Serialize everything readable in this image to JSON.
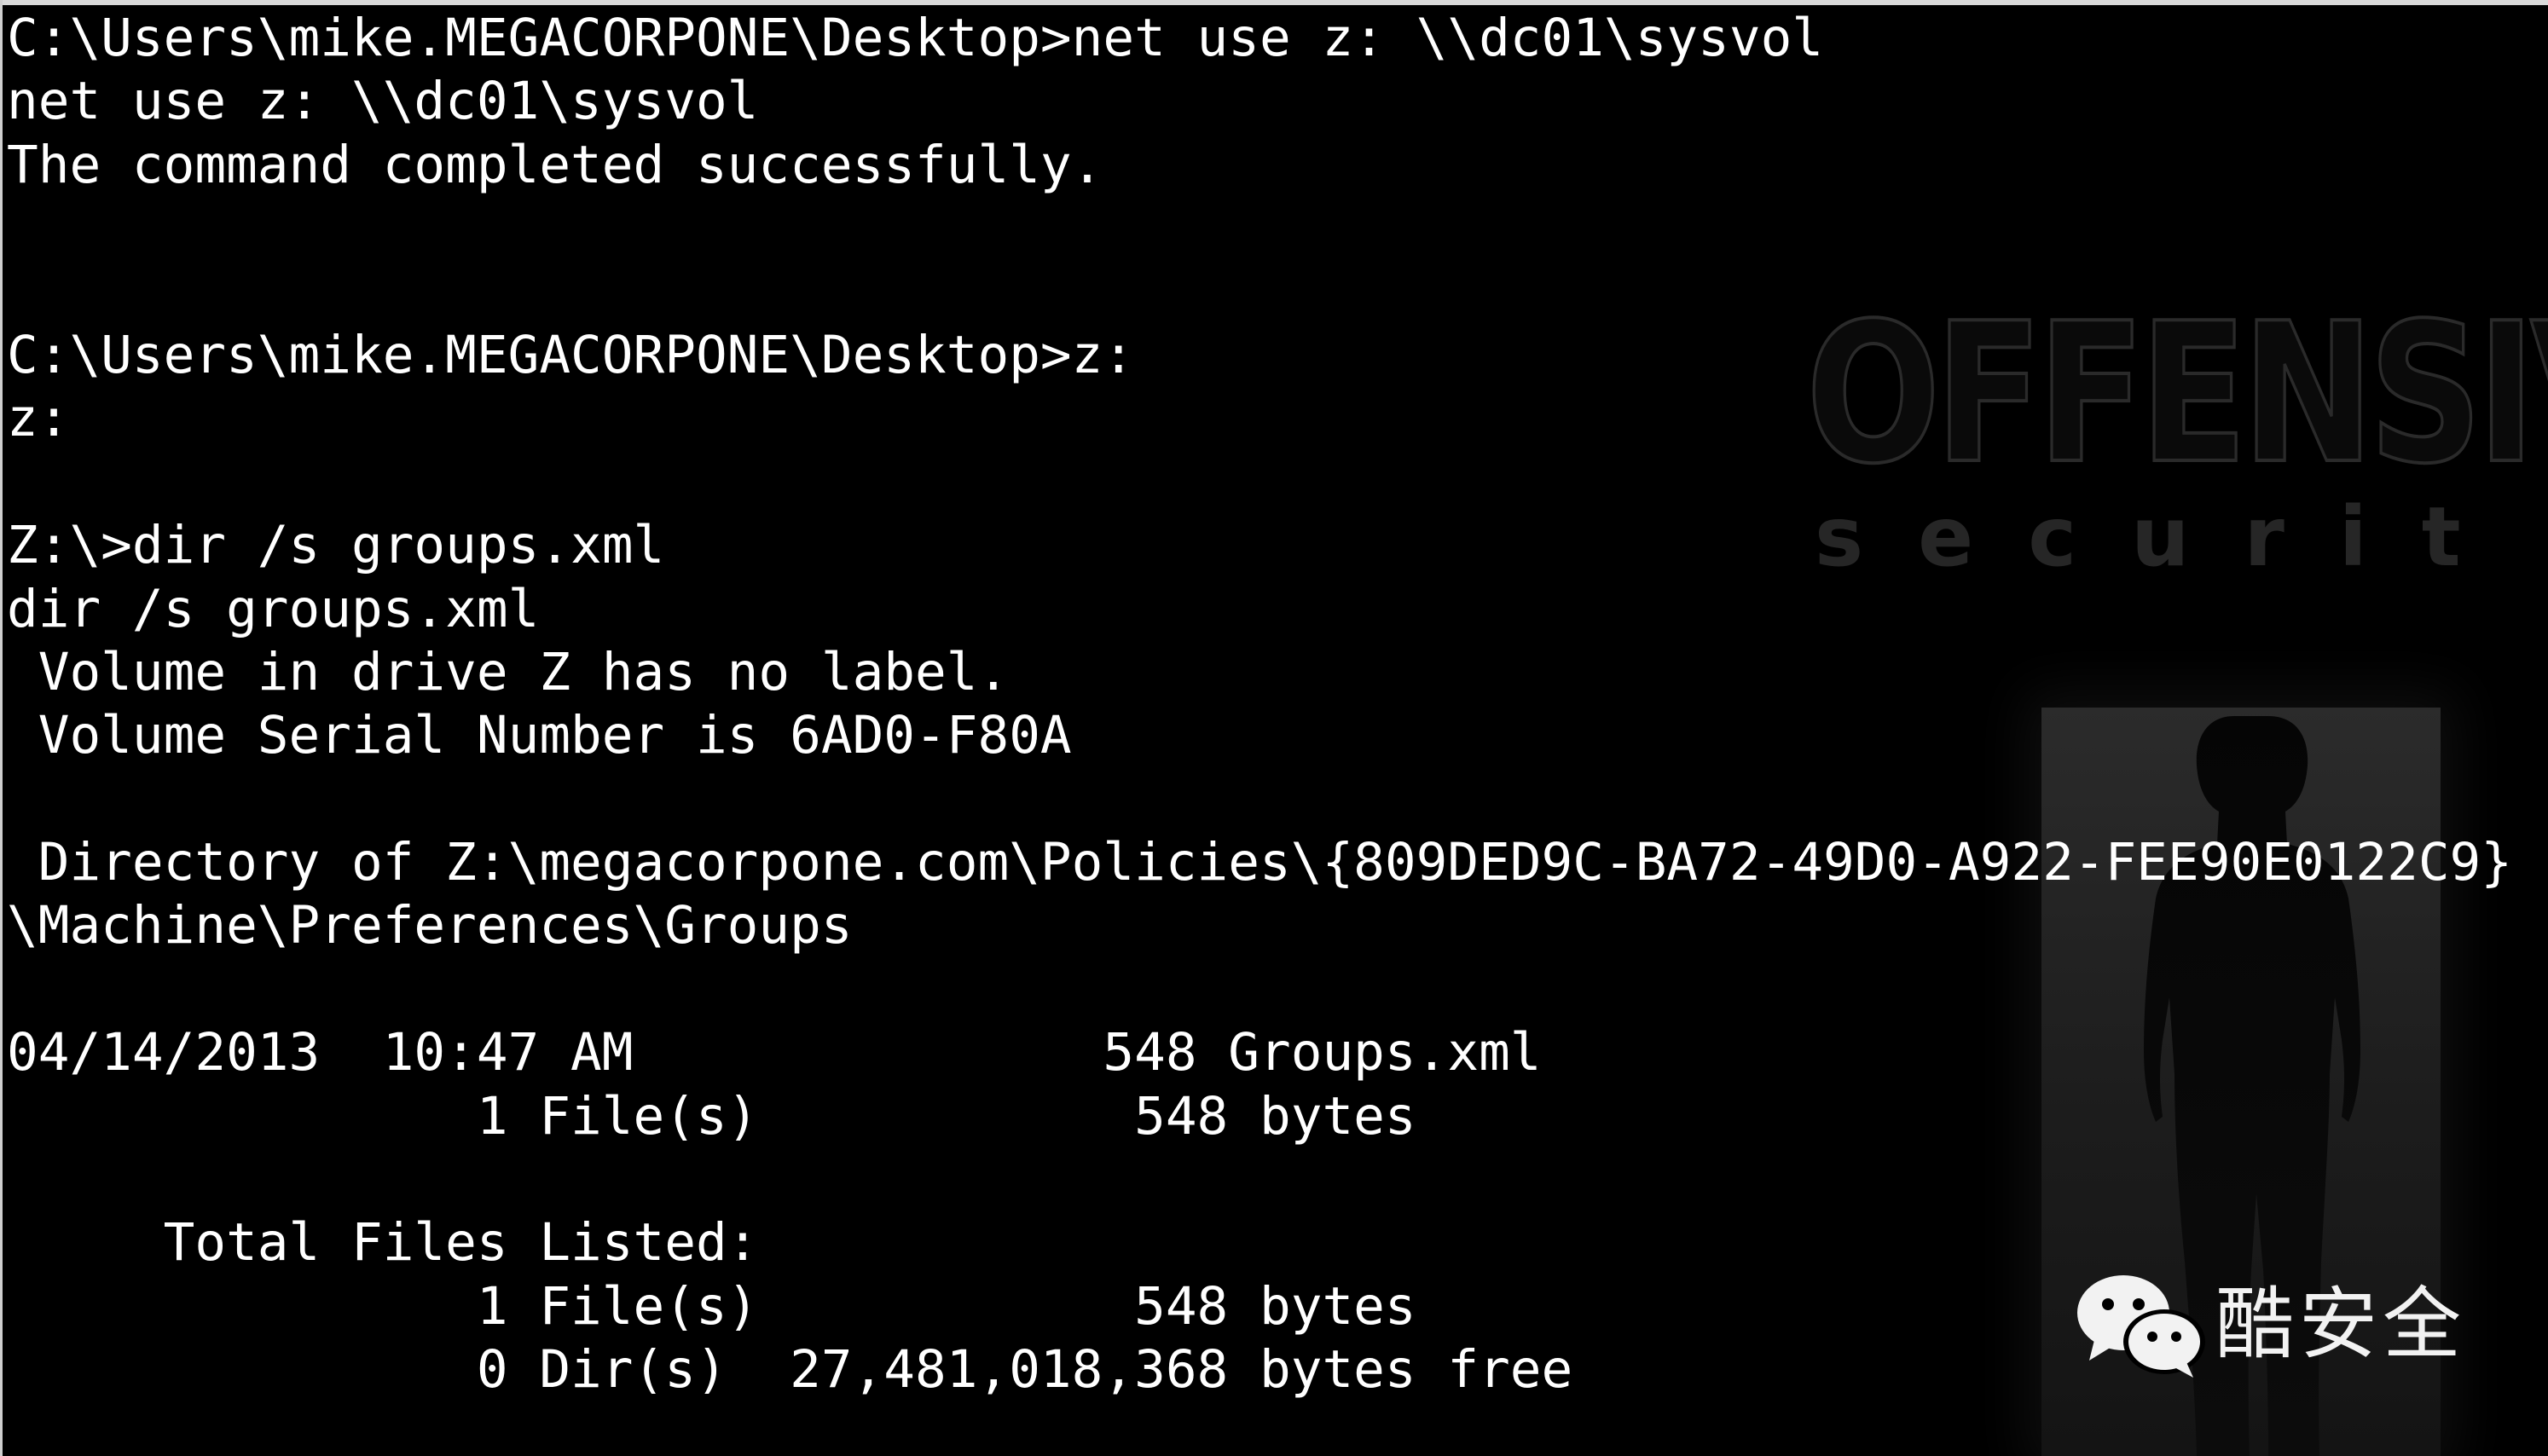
{
  "terminal": {
    "lines": [
      "C:\\Users\\mike.MEGACORPONE\\Desktop>net use z: \\\\dc01\\sysvol",
      "net use z: \\\\dc01\\sysvol",
      "The command completed successfully.",
      "",
      "",
      "C:\\Users\\mike.MEGACORPONE\\Desktop>z:",
      "z:",
      "",
      "Z:\\>dir /s groups.xml",
      "dir /s groups.xml",
      " Volume in drive Z has no label.",
      " Volume Serial Number is 6AD0-F80A",
      "",
      " Directory of Z:\\megacorpone.com\\Policies\\{809DED9C-BA72-49D0-A922-FEE90E0122C9}",
      "\\Machine\\Preferences\\Groups",
      "",
      "04/14/2013  10:47 AM               548 Groups.xml",
      "               1 File(s)            548 bytes",
      "",
      "     Total Files Listed:",
      "               1 File(s)            548 bytes",
      "               0 Dir(s)  27,481,018,368 bytes free"
    ]
  },
  "wallpaper": {
    "brand_word": "OFFENSIV",
    "brand_sub": "securit"
  },
  "badge": {
    "icon": "wechat-icon",
    "label": "酷安全"
  },
  "colors": {
    "background": "#000000",
    "text": "#ffffff"
  }
}
